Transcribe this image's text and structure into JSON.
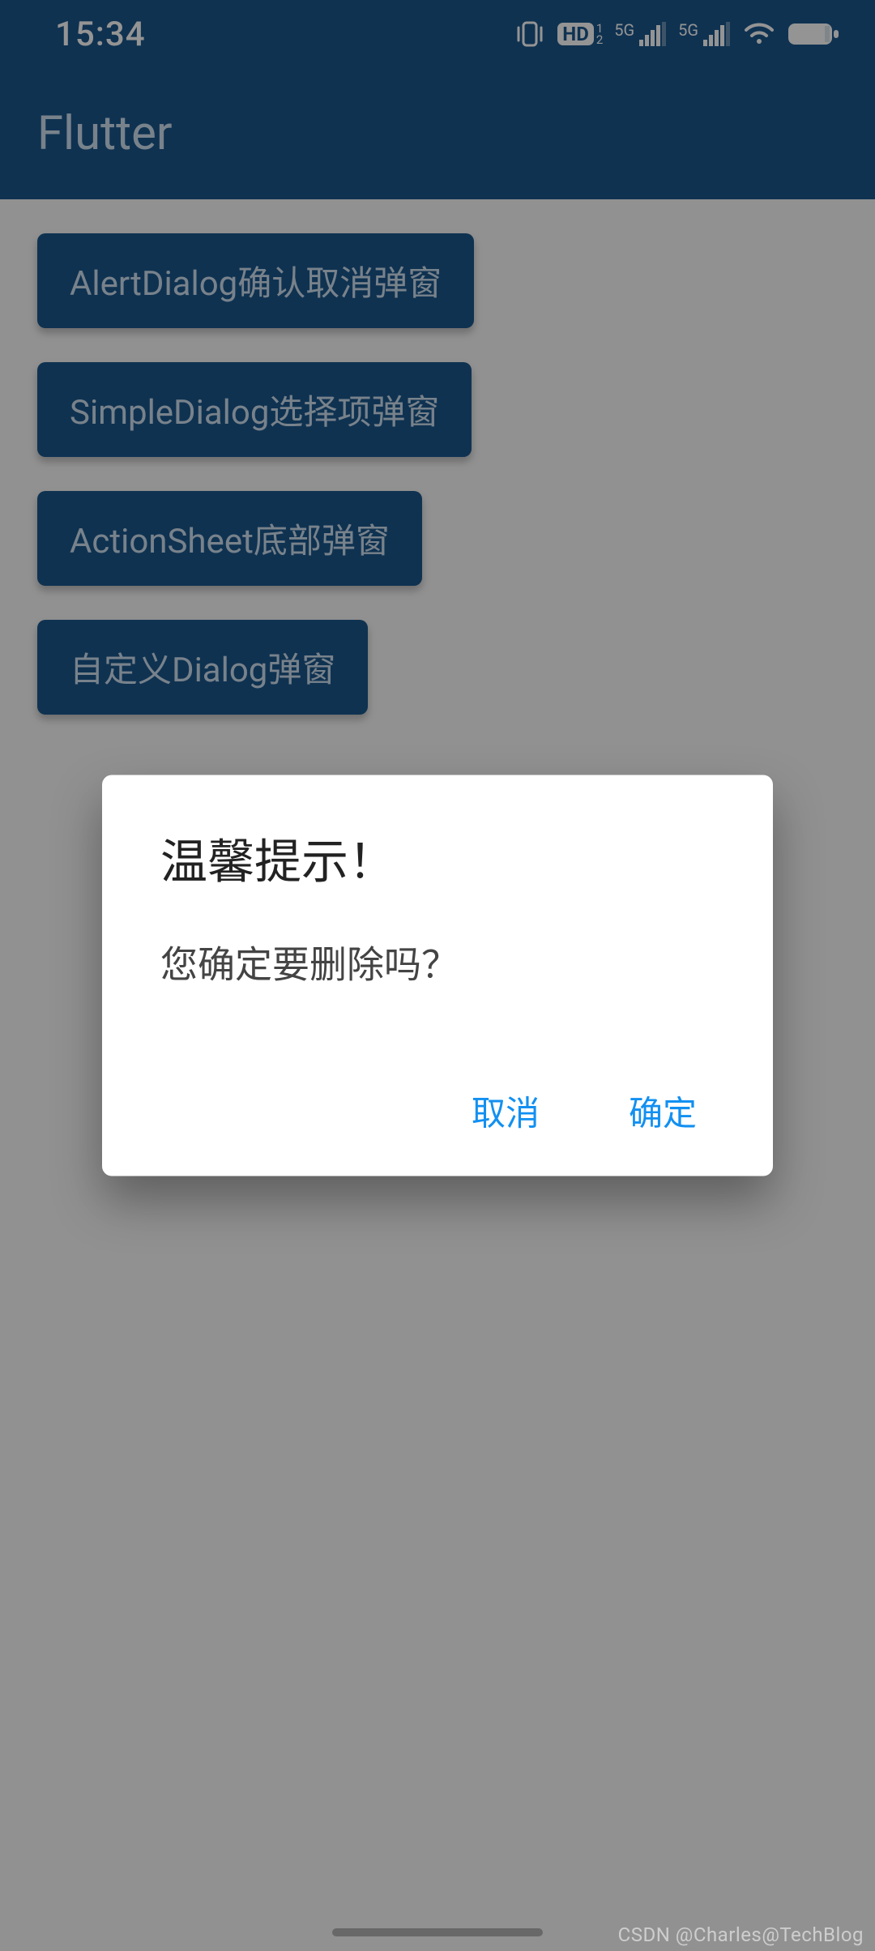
{
  "statusbar": {
    "time": "15:34",
    "icons": {
      "vibrate": "vibrate-icon",
      "hd": "HD",
      "hd_sub": "1\n2",
      "sig1_label": "5G",
      "sig2_label": "5G"
    }
  },
  "appbar": {
    "title": "Flutter"
  },
  "buttons": [
    "AlertDialog确认取消弹窗",
    "SimpleDialog选择项弹窗",
    "ActionSheet底部弹窗",
    "自定义Dialog弹窗"
  ],
  "dialog": {
    "title": "温馨提示！",
    "content": "您确定要删除吗？",
    "cancel": "取消",
    "confirm": "确定"
  },
  "watermark": "CSDN @Charles@TechBlog"
}
